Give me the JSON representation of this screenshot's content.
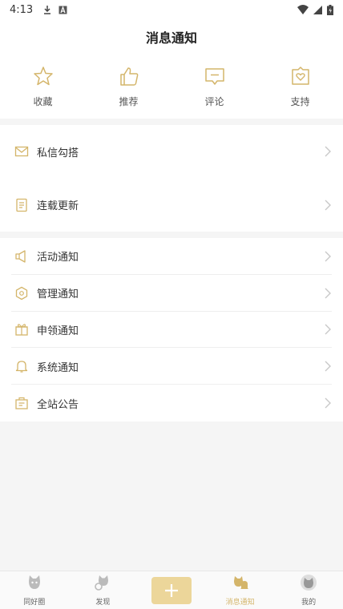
{
  "status_bar": {
    "time": "4:13",
    "icons_left": [
      "download-icon",
      "a-badge-icon"
    ],
    "icons_right": [
      "wifi-icon",
      "signal-icon",
      "battery-icon"
    ]
  },
  "header": {
    "title": "消息通知"
  },
  "quick_actions": [
    {
      "label": "收藏",
      "icon": "star-icon"
    },
    {
      "label": "推荐",
      "icon": "thumbs-up-icon"
    },
    {
      "label": "评论",
      "icon": "comment-icon"
    },
    {
      "label": "支持",
      "icon": "gift-heart-icon"
    }
  ],
  "group1": [
    {
      "label": "私信勾搭",
      "icon": "mail-icon"
    },
    {
      "label": "连载更新",
      "icon": "document-icon"
    }
  ],
  "group2": [
    {
      "label": "活动通知",
      "icon": "megaphone-icon"
    },
    {
      "label": "管理通知",
      "icon": "hexagon-icon"
    },
    {
      "label": "申领通知",
      "icon": "gift-icon"
    },
    {
      "label": "系统通知",
      "icon": "bell-icon"
    },
    {
      "label": "全站公告",
      "icon": "bulletin-icon"
    }
  ],
  "tabbar": [
    {
      "label": "同好圈",
      "icon": "cat-circle-icon",
      "active": false
    },
    {
      "label": "发现",
      "icon": "cat-discover-icon",
      "active": false
    },
    {
      "label": "",
      "icon": "plus-icon",
      "active": false
    },
    {
      "label": "消息通知",
      "icon": "cat-bell-icon",
      "active": true
    },
    {
      "label": "我的",
      "icon": "cat-avatar-icon",
      "active": false
    }
  ],
  "colors": {
    "accent": "#d4b56a",
    "add_button": "#ecd69a",
    "background": "#f5f5f5"
  }
}
